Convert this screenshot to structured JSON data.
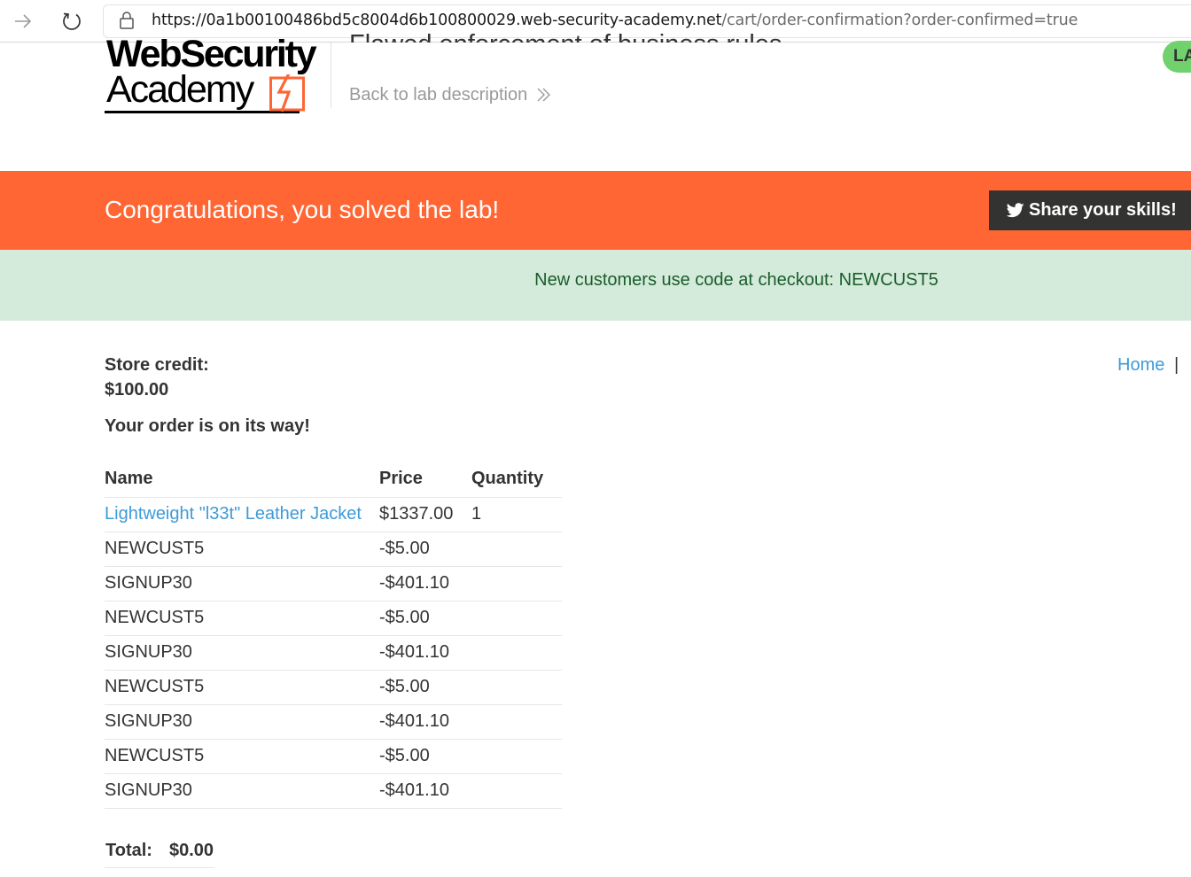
{
  "browser": {
    "url_main": "https://0a1b00100486bd5c8004d6b100800029.web-security-academy.net",
    "url_path": "/cart/order-confirmation?order-confirmed=true"
  },
  "header": {
    "logo_line1": "WebSecurity",
    "logo_line2": "Academy",
    "lab_title": "Flawed enforcement of business rules",
    "back_link": "Back to lab description",
    "lab_status": "LA"
  },
  "banner": {
    "solved_text": "Congratulations, you solved the lab!",
    "share_label": "Share your skills!"
  },
  "notice": {
    "text": "New customers use code at checkout: NEWCUST5"
  },
  "account": {
    "store_credit_label": "Store credit:",
    "store_credit_value": "$100.00"
  },
  "nav": {
    "home": "Home",
    "separator": "|"
  },
  "order": {
    "message": "Your order is on its way!",
    "columns": [
      "Name",
      "Price",
      "Quantity"
    ],
    "rows": [
      {
        "name": "Lightweight \"l33t\" Leather Jacket",
        "price": "$1337.00",
        "quantity": "1"
      },
      {
        "name": "NEWCUST5",
        "price": "-$5.00",
        "quantity": ""
      },
      {
        "name": "SIGNUP30",
        "price": "-$401.10",
        "quantity": ""
      },
      {
        "name": "NEWCUST5",
        "price": "-$5.00",
        "quantity": ""
      },
      {
        "name": "SIGNUP30",
        "price": "-$401.10",
        "quantity": ""
      },
      {
        "name": "NEWCUST5",
        "price": "-$5.00",
        "quantity": ""
      },
      {
        "name": "SIGNUP30",
        "price": "-$401.10",
        "quantity": ""
      },
      {
        "name": "NEWCUST5",
        "price": "-$5.00",
        "quantity": ""
      },
      {
        "name": "SIGNUP30",
        "price": "-$401.10",
        "quantity": ""
      }
    ],
    "total_label": "Total:",
    "total_value": "$0.00"
  },
  "colors": {
    "accent_orange": "#ff6633",
    "link_blue": "#3d9bd9",
    "notice_bg": "#d4ebdb",
    "status_green": "#70d16d"
  }
}
